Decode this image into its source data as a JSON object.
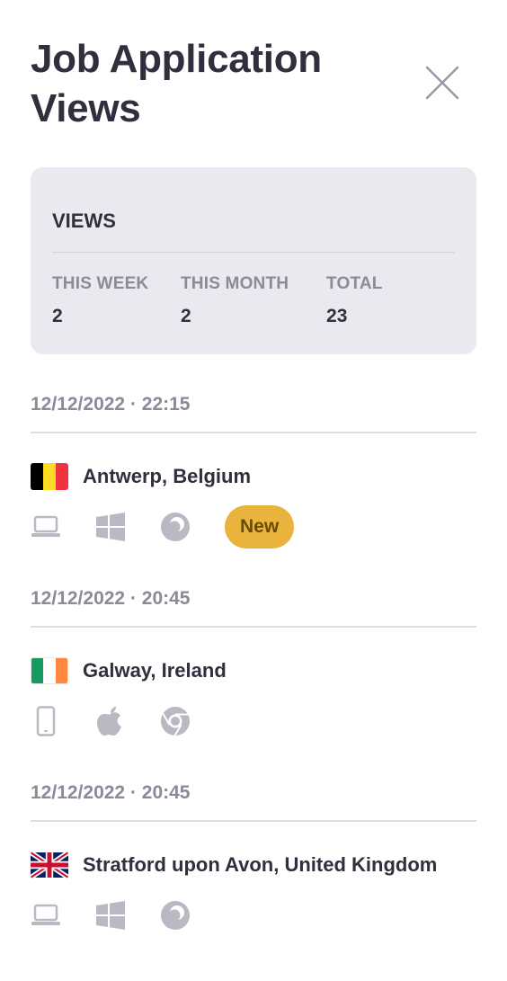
{
  "header": {
    "title": "Job Application Views"
  },
  "stats": {
    "title": "VIEWS",
    "this_week_label": "THIS WEEK",
    "this_week_value": "2",
    "this_month_label": "THIS MONTH",
    "this_month_value": "2",
    "total_label": "TOTAL",
    "total_value": "23"
  },
  "entries": [
    {
      "datetime": "12/12/2022 · 22:15",
      "location": "Antwerp, Belgium",
      "flag_colors": [
        "#000000",
        "#FDDA24",
        "#EF3340"
      ],
      "device_icon": "laptop-icon",
      "os_icon": "windows-icon",
      "browser_icon": "firefox-icon",
      "badge": "New"
    },
    {
      "datetime": "12/12/2022 · 20:45",
      "location": "Galway, Ireland",
      "flag_colors": [
        "#169B62",
        "#FFFFFF",
        "#FF883E"
      ],
      "device_icon": "phone-icon",
      "os_icon": "apple-icon",
      "browser_icon": "chrome-icon"
    },
    {
      "datetime": "12/12/2022 · 20:45",
      "location": "Stratford upon Avon, United Kingdom",
      "flag": "uk",
      "device_icon": "laptop-icon",
      "os_icon": "windows-icon",
      "browser_icon": "firefox-icon"
    }
  ],
  "colors": {
    "icon_gray": "#b9b9c4",
    "badge_bg": "#eab43c",
    "badge_text": "#6b4a05",
    "card_bg": "#e9e9ef"
  }
}
